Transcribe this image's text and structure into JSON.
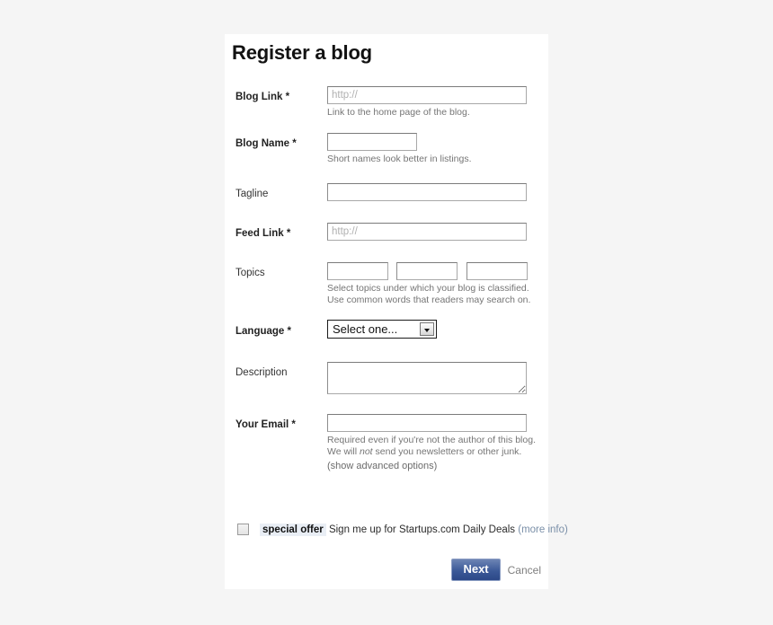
{
  "page": {
    "title": "Register a blog"
  },
  "fields": {
    "blog_link": {
      "label": "Blog Link *",
      "placeholder": "http://",
      "value": "",
      "hint": "Link to the home page of the blog."
    },
    "blog_name": {
      "label": "Blog Name *",
      "placeholder": "",
      "value": "",
      "hint": "Short names look better in listings."
    },
    "tagline": {
      "label": "Tagline",
      "placeholder": "",
      "value": ""
    },
    "feed_link": {
      "label": "Feed Link *",
      "placeholder": "http://",
      "value": ""
    },
    "topics": {
      "label": "Topics",
      "values": [
        "",
        "",
        ""
      ],
      "hint_line1": "Select topics under which your blog is classified.",
      "hint_line2": "Use common words that readers may search on."
    },
    "language": {
      "label": "Language *",
      "selected": "Select one...",
      "options": [
        "Select one..."
      ]
    },
    "description": {
      "label": "Description",
      "placeholder": "",
      "value": ""
    },
    "your_email": {
      "label": "Your Email *",
      "placeholder": "",
      "value": "",
      "hint_line1": "Required even if you're not the author of this blog.",
      "hint_line2_pre": "We will ",
      "hint_line2_em": "not",
      "hint_line2_post": " send you newsletters or other junk."
    }
  },
  "advanced_toggle": "(show advanced options)",
  "offer": {
    "badge": "special offer",
    "text": "Sign me up for Startups.com Daily Deals",
    "more_info": "(more info)",
    "checked": false
  },
  "actions": {
    "next": "Next",
    "cancel": "Cancel"
  },
  "colors": {
    "page_background": "#f5f5f5",
    "card_background": "#ffffff",
    "next_button": "#3b5998",
    "next_button_border": "#8b9dc3",
    "badge_background": "#e9eef5",
    "link": "#7a8fa8",
    "hint_text": "#757575"
  }
}
